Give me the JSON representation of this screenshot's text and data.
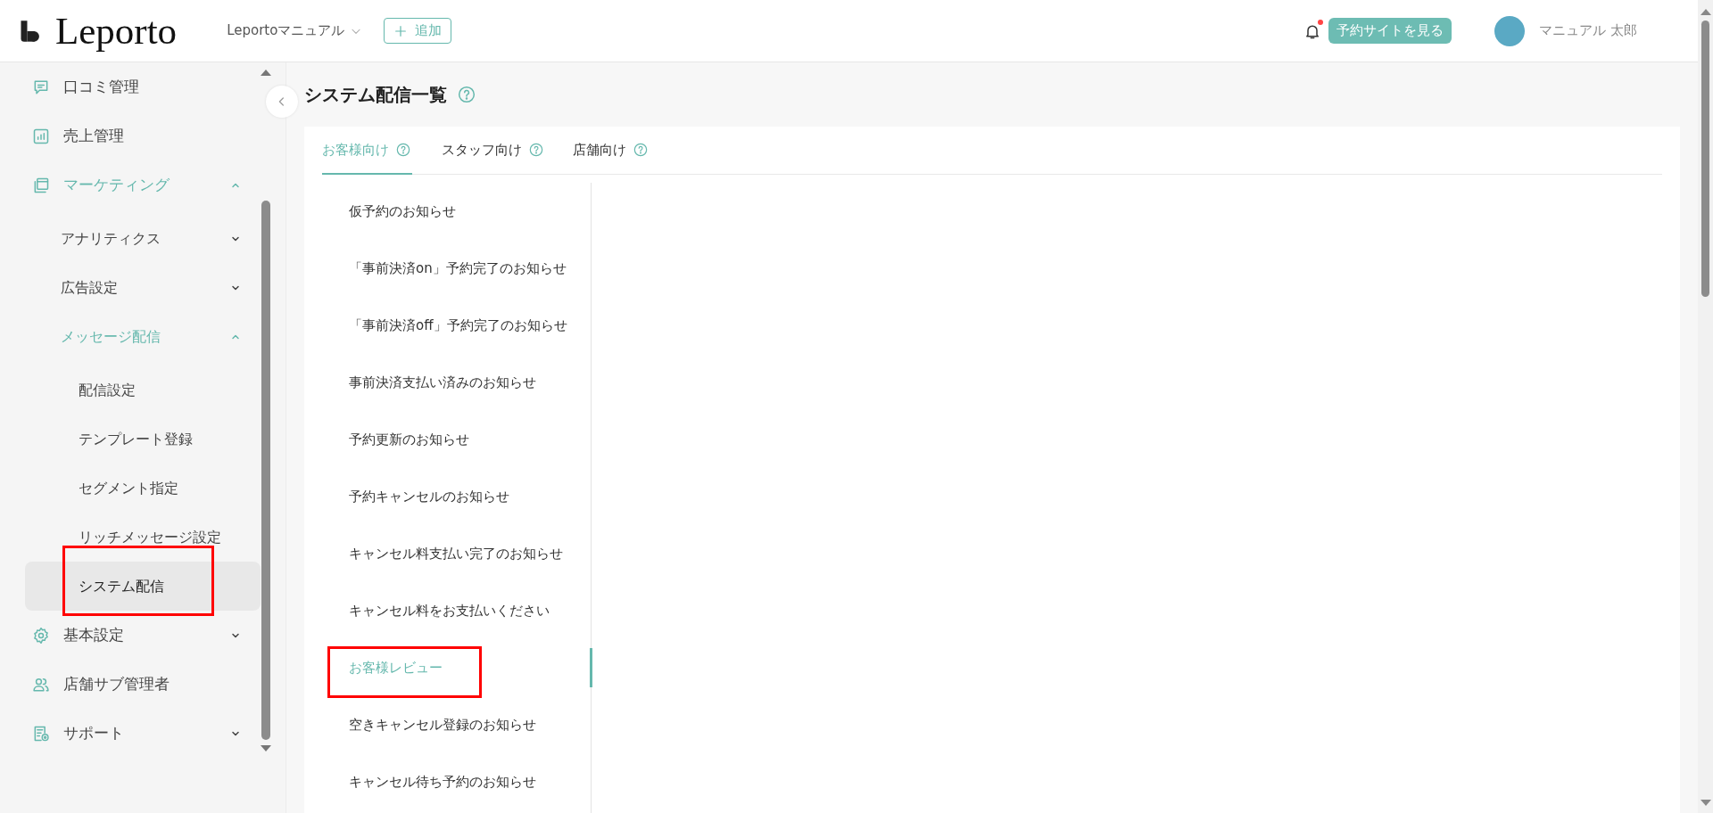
{
  "header": {
    "brand": "Leporto",
    "store_selector": "Leportoマニュアル",
    "add_button": "追加",
    "notification_unread": true,
    "site_button": "予約サイトを見る",
    "user_name": "マニュアル 太郎"
  },
  "sidebar": {
    "items": [
      {
        "label": "口コミ管理",
        "selected": false,
        "highlighted": false
      },
      {
        "label": "売上管理",
        "selected": false,
        "highlighted": false
      },
      {
        "label": "マーケティング",
        "selected": false,
        "highlighted": false,
        "expanded": true,
        "children": [
          {
            "label": "アナリティクス",
            "selected": false,
            "highlighted": false,
            "expanded": false
          },
          {
            "label": "広告設定",
            "selected": false,
            "highlighted": false,
            "expanded": false
          },
          {
            "label": "メッセージ配信",
            "selected": false,
            "highlighted": false,
            "expanded": true,
            "children": [
              {
                "label": "配信設定",
                "selected": false,
                "highlighted": false
              },
              {
                "label": "テンプレート登録",
                "selected": false,
                "highlighted": false
              },
              {
                "label": "セグメント指定",
                "selected": false,
                "highlighted": false
              },
              {
                "label": "リッチメッセージ設定",
                "selected": false,
                "highlighted": false
              },
              {
                "label": "システム配信",
                "selected": true,
                "highlighted": true
              }
            ]
          }
        ]
      },
      {
        "label": "基本設定",
        "selected": false,
        "highlighted": false,
        "expanded": false
      },
      {
        "label": "店舗サブ管理者",
        "selected": false,
        "highlighted": false
      },
      {
        "label": "サポート",
        "selected": false,
        "highlighted": false,
        "expanded": false
      }
    ]
  },
  "page": {
    "title": "システム配信一覧",
    "tabs": [
      {
        "label": "お客様向け",
        "selected": true
      },
      {
        "label": "スタッフ向け",
        "selected": false
      },
      {
        "label": "店舗向け",
        "selected": false
      }
    ],
    "notifications": [
      {
        "label": "仮予約のお知らせ",
        "selected": false,
        "highlighted": false
      },
      {
        "label": "「事前決済on」予約完了のお知らせ",
        "selected": false,
        "highlighted": false
      },
      {
        "label": "「事前決済off」予約完了のお知らせ",
        "selected": false,
        "highlighted": false
      },
      {
        "label": "事前決済支払い済みのお知らせ",
        "selected": false,
        "highlighted": false
      },
      {
        "label": "予約更新のお知らせ",
        "selected": false,
        "highlighted": false
      },
      {
        "label": "予約キャンセルのお知らせ",
        "selected": false,
        "highlighted": false
      },
      {
        "label": "キャンセル料支払い完了のお知らせ",
        "selected": false,
        "highlighted": false
      },
      {
        "label": "キャンセル料をお支払いください",
        "selected": false,
        "highlighted": false
      },
      {
        "label": "お客様レビュー",
        "selected": true,
        "highlighted": true
      },
      {
        "label": "空きキャンセル登録のお知らせ",
        "selected": false,
        "highlighted": false
      },
      {
        "label": "キャンセル待ち予約のお知らせ",
        "selected": false,
        "highlighted": false
      }
    ]
  }
}
